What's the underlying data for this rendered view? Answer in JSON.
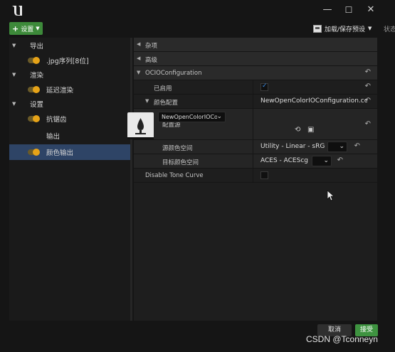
{
  "titlebar": {
    "logo_icon": "unreal-logo-icon",
    "minimize": "—",
    "maximize": "☐",
    "close": "✕"
  },
  "toolbar": {
    "settings_label": "设置",
    "preset_label": "加载/保存预设",
    "status_label": "状态"
  },
  "left_tree": {
    "items": [
      {
        "label": "导出",
        "type": "category"
      },
      {
        "label": ".jpg序列[8位]",
        "type": "setting",
        "enabled": true
      },
      {
        "label": "渲染",
        "type": "category"
      },
      {
        "label": "延迟渲染",
        "type": "setting",
        "enabled": true
      },
      {
        "label": "设置",
        "type": "category"
      },
      {
        "label": "抗锯齿",
        "type": "setting",
        "enabled": true
      },
      {
        "label": "输出",
        "type": "setting",
        "enabled": false
      },
      {
        "label": "颜色输出",
        "type": "setting",
        "enabled": true,
        "selected": true
      }
    ]
  },
  "details": {
    "cat_misc": "杂项",
    "cat_advanced": "高级",
    "cat_ocio": "OCIOConfiguration",
    "enabled_label": "已启用",
    "enabled_value": true,
    "color_config_label": "颜色配置",
    "color_config_value": "NewOpenColorIOConfiguration.co",
    "config_source_label": "配置源",
    "config_asset": "NewOpenColorIOConfiguration",
    "source_space_label": "源颜色空间",
    "source_space_value": "Utility - Linear - sRGB",
    "dest_space_label": "目标颜色空间",
    "dest_space_value": "ACES - ACEScg",
    "tone_curve_label": "Disable Tone Curve",
    "tone_curve_value": false,
    "reset_icon": "↶"
  },
  "footer": {
    "cancel_label": "取消",
    "accept_label": "接受",
    "watermark": "CSDN @Tconneyn"
  },
  "colors": {
    "accent_green": "#3e9340",
    "selection_blue": "#2e4466",
    "toggle_orange": "#e6a318"
  }
}
